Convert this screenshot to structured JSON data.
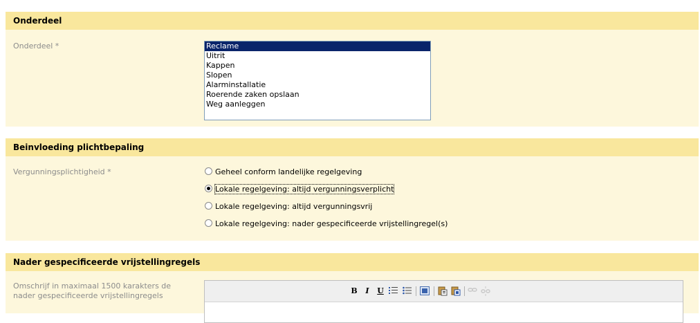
{
  "sections": {
    "onderdeel": {
      "title": "Onderdeel",
      "field_label": "Onderdeel *",
      "list_items": [
        {
          "label": "Reclame",
          "selected": true
        },
        {
          "label": "Uitrit",
          "selected": false
        },
        {
          "label": "Kappen",
          "selected": false
        },
        {
          "label": "Slopen",
          "selected": false
        },
        {
          "label": "Alarminstallatie",
          "selected": false
        },
        {
          "label": "Roerende zaken opslaan",
          "selected": false
        },
        {
          "label": "Weg aanleggen",
          "selected": false
        }
      ]
    },
    "beinvloeding": {
      "title": "Beinvloeding plichtbepaling",
      "field_label": "Vergunningsplichtigheid *",
      "options": [
        {
          "label": "Geheel conform landelijke regelgeving",
          "checked": false
        },
        {
          "label": "Lokale regelgeving: altijd vergunningsverplicht",
          "checked": true
        },
        {
          "label": "Lokale regelgeving: altijd vergunningsvrij",
          "checked": false
        },
        {
          "label": "Lokale regelgeving: nader gespecificeerde vrijstellingregel(s)",
          "checked": false
        }
      ]
    },
    "vrijstelling": {
      "title": "Nader gespecificeerde vrijstellingregels",
      "field_label_line1": "Omschrijf in maximaal 1500 karakters de",
      "field_label_line2": "nader gespecificeerde vrijstellingregels",
      "toolbar": {
        "bold": "B",
        "italic": "I",
        "underline": "U",
        "icons": [
          "bold-icon",
          "italic-icon",
          "underline-icon",
          "ordered-list-icon",
          "unordered-list-icon",
          "select-all-icon",
          "paste-text-icon",
          "paste-word-icon",
          "link-icon",
          "unlink-icon"
        ]
      }
    }
  },
  "colors": {
    "header_bg": "#f9e79d",
    "section_bg": "#fdf7dc",
    "selected_bg": "#0a246a",
    "label_color": "#8c8c8c"
  }
}
